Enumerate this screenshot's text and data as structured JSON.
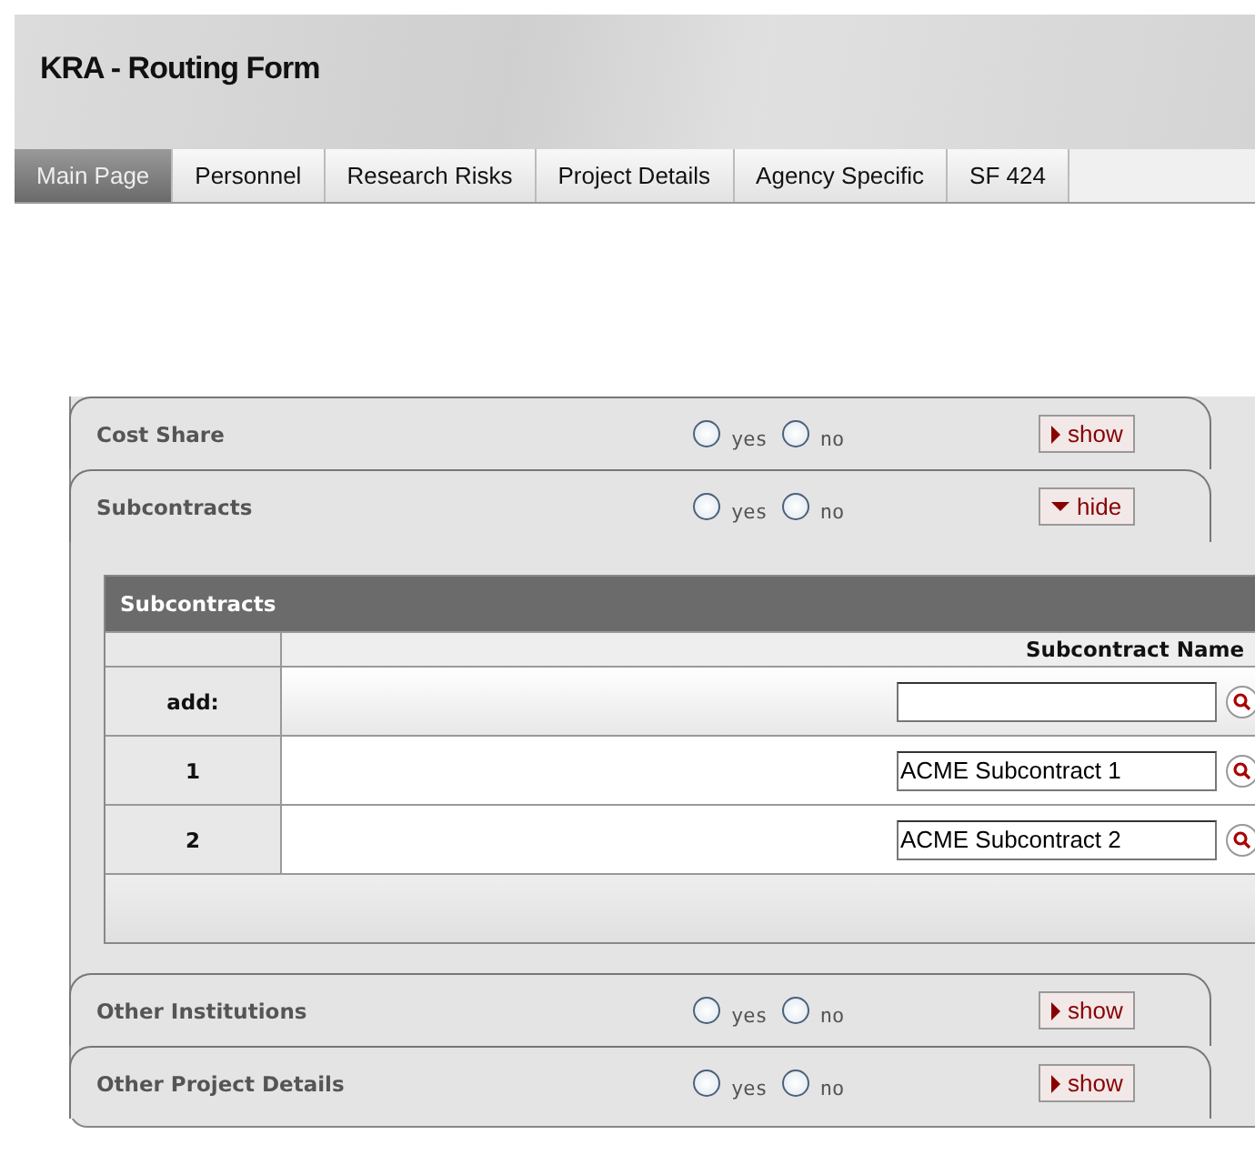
{
  "header": {
    "title": "KRA - Routing Form"
  },
  "tabs": [
    {
      "label": "Main Page",
      "selected": true
    },
    {
      "label": "Personnel",
      "selected": false
    },
    {
      "label": "Research Risks",
      "selected": false
    },
    {
      "label": "Project Details",
      "selected": false
    },
    {
      "label": "Agency Specific",
      "selected": false
    },
    {
      "label": "SF 424",
      "selected": false
    }
  ],
  "sections": [
    {
      "title": "Cost Share",
      "options": [
        {
          "label": "yes",
          "selected": false
        },
        {
          "label": "no",
          "selected": false
        }
      ],
      "toggle": "show",
      "expanded": false
    },
    {
      "title": "Subcontracts",
      "options": [
        {
          "label": "yes",
          "selected": false
        },
        {
          "label": "no",
          "selected": false
        }
      ],
      "toggle": "hide",
      "expanded": true,
      "table": {
        "title": "Subcontracts",
        "columns": [
          "Subcontract Name"
        ],
        "rows": [
          {
            "label": "add:",
            "value": ""
          },
          {
            "label": "1",
            "value": "ACME Subcontract 1"
          },
          {
            "label": "2",
            "value": "ACME Subcontract 2"
          }
        ]
      }
    },
    {
      "title": "Other Institutions",
      "options": [
        {
          "label": "yes",
          "selected": false
        },
        {
          "label": "no",
          "selected": false
        }
      ],
      "toggle": "show",
      "expanded": false
    },
    {
      "title": "Other Project Details",
      "options": [
        {
          "label": "yes",
          "selected": false
        },
        {
          "label": "no",
          "selected": false
        }
      ],
      "toggle": "show",
      "expanded": false
    }
  ]
}
